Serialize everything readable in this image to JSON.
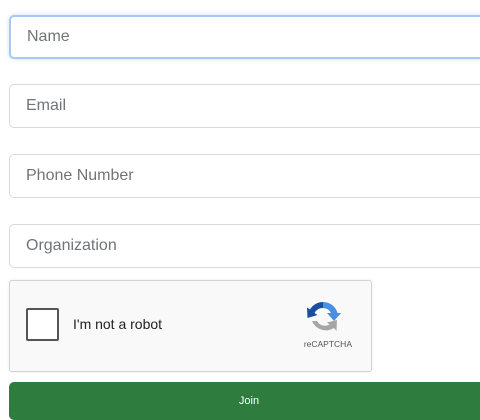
{
  "form": {
    "fields": [
      {
        "id": "name",
        "placeholder": "Name",
        "value": ""
      },
      {
        "id": "email",
        "placeholder": "Email",
        "value": ""
      },
      {
        "id": "phone",
        "placeholder": "Phone Number",
        "value": ""
      },
      {
        "id": "organization",
        "placeholder": "Organization",
        "value": ""
      }
    ],
    "focused_field": "name",
    "captcha": {
      "label": "I'm not a robot",
      "brand": "reCAPTCHA",
      "checked": false,
      "logo_icon": "recaptcha-logo-icon"
    },
    "submit_label": "Join"
  },
  "colors": {
    "submit_bg": "#2f7d3e",
    "focus_border": "#a9c8f4",
    "field_border": "#d7dade",
    "placeholder": "#70757a"
  }
}
